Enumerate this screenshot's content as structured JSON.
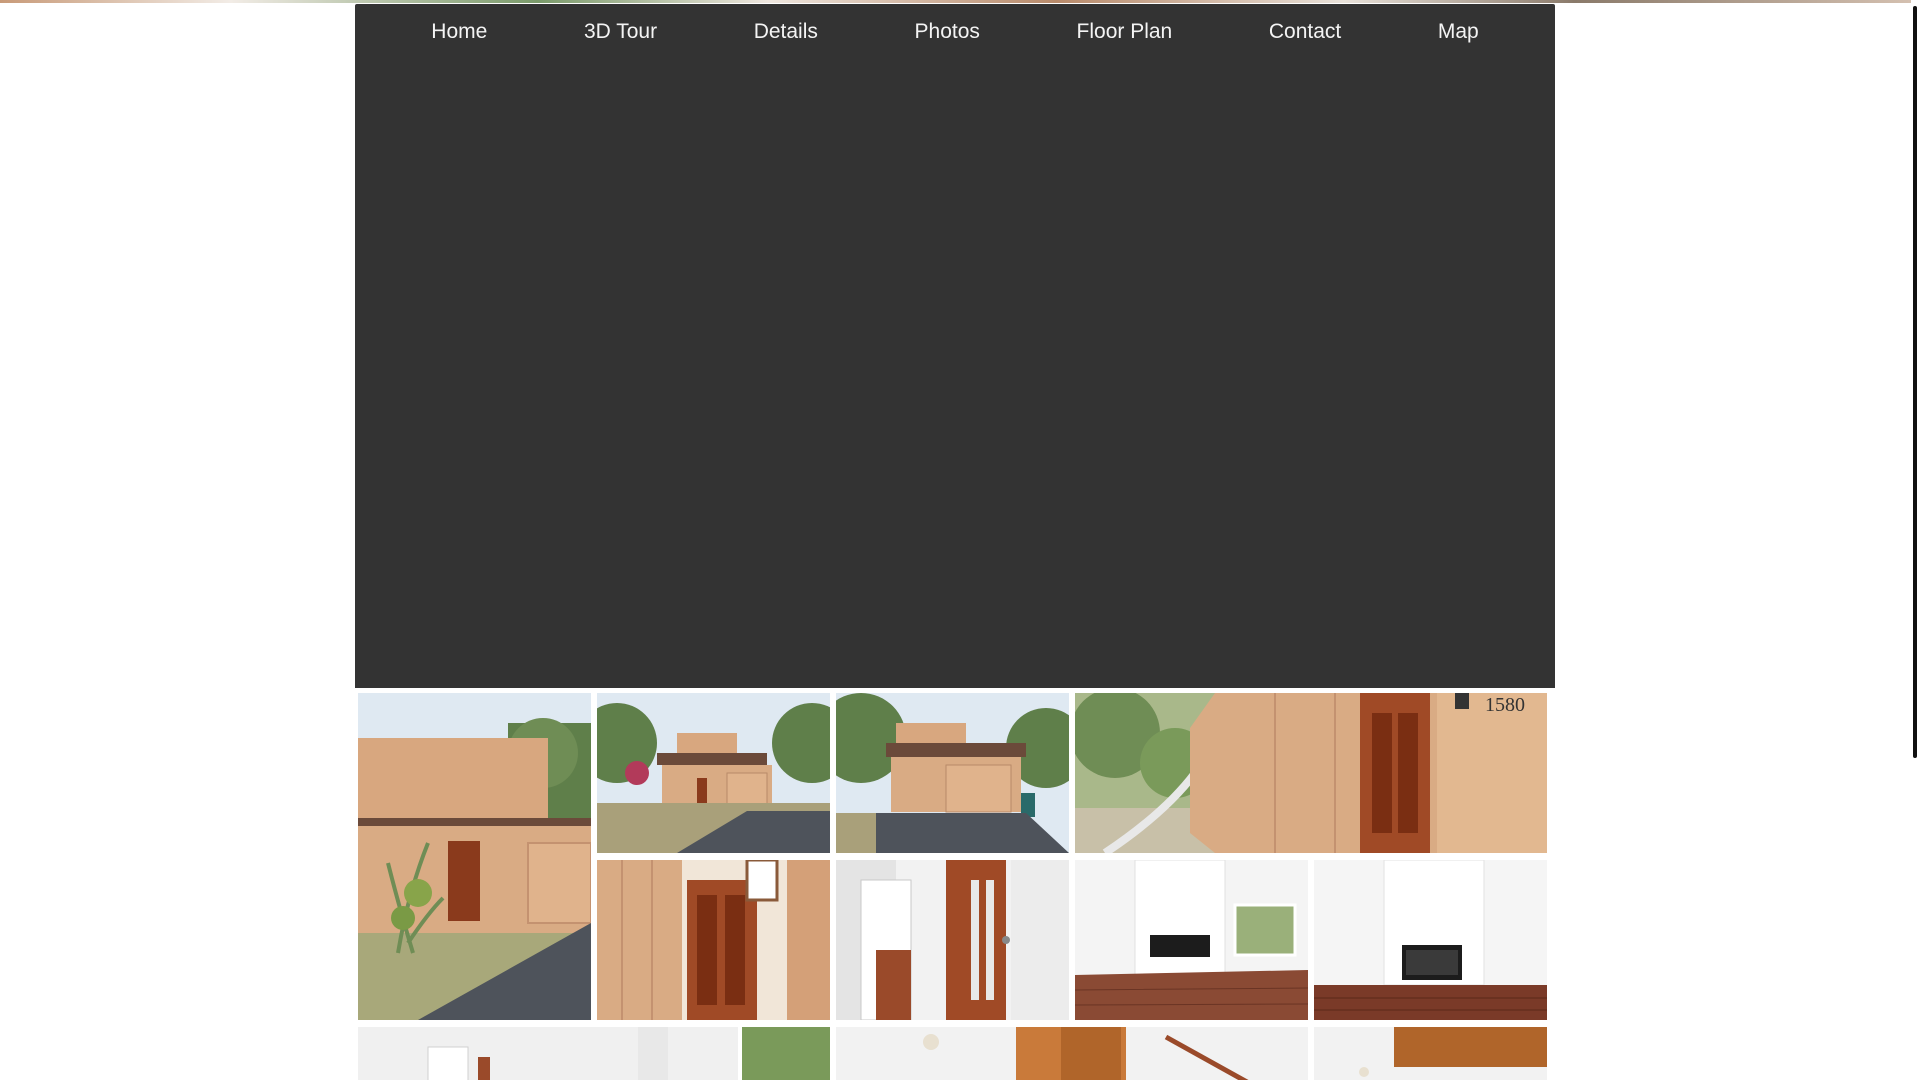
{
  "nav": {
    "items": [
      {
        "label": "Home"
      },
      {
        "label": "3D Tour"
      },
      {
        "label": "Details"
      },
      {
        "label": "Photos"
      },
      {
        "label": "Floor Plan"
      },
      {
        "label": "Contact"
      },
      {
        "label": "Map"
      }
    ]
  },
  "gallery": {
    "address_number": "1580"
  },
  "colors": {
    "nav_bg": "#333333",
    "hero_bg": "#333333",
    "nav_text": "#f4f4f4",
    "siding": "#d8a77f",
    "door": "#8a3a1c",
    "sky": "#dfe9f2",
    "asphalt": "#5a5e66",
    "foliage": "#6f8d55",
    "floor_wood": "#8a4a34"
  }
}
